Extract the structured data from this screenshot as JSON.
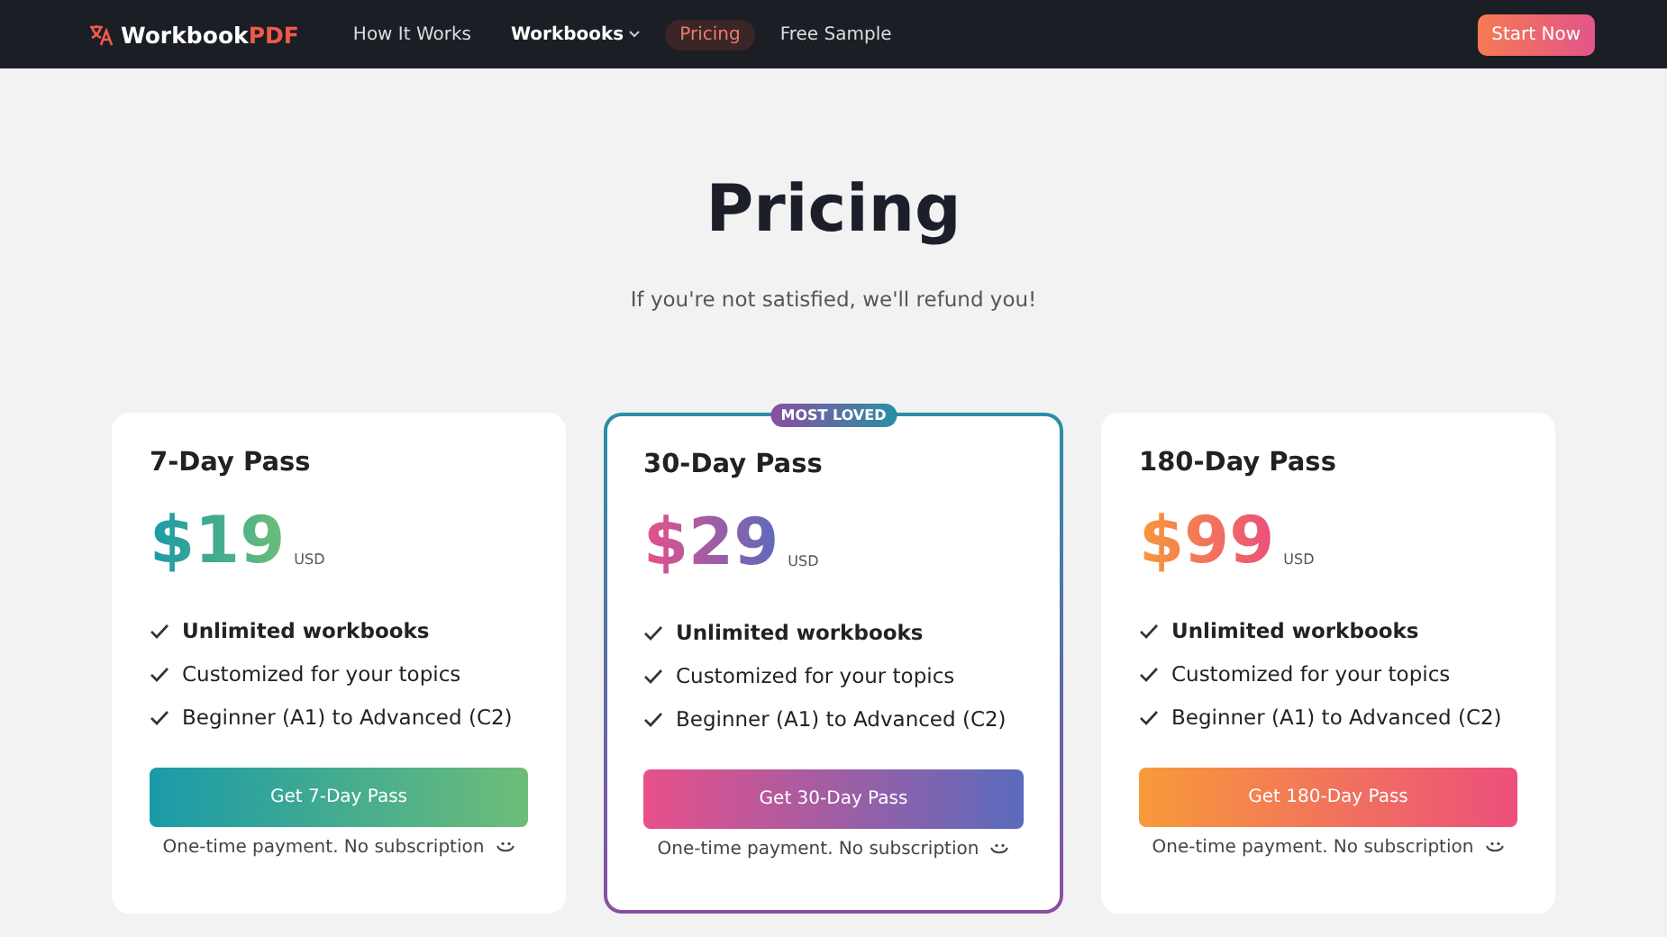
{
  "nav": {
    "brand": {
      "name": "Workbook",
      "accent": "PDF"
    },
    "links": [
      {
        "label": "How It Works",
        "selected": false,
        "dropdown": false
      },
      {
        "label": "Workbooks",
        "selected": false,
        "dropdown": true
      },
      {
        "label": "Pricing",
        "selected": true,
        "dropdown": false
      },
      {
        "label": "Free Sample",
        "selected": false,
        "dropdown": false
      }
    ],
    "cta": "Start Now"
  },
  "header": {
    "title": "Pricing",
    "subtitle": "If you're not satisfied, we'll refund you!"
  },
  "plans": [
    {
      "name": "7-Day Pass",
      "price": "$19",
      "currency": "USD",
      "kind": "teal",
      "featured": false,
      "features": [
        {
          "text": "Unlimited workbooks",
          "bold": true
        },
        {
          "text": "Customized for your topics",
          "bold": false
        },
        {
          "text": "Beginner (A1) to Advanced (C2)",
          "bold": false
        }
      ],
      "button": "Get 7-Day Pass",
      "note": "One-time payment. No subscription"
    },
    {
      "name": "30-Day Pass",
      "price": "$29",
      "currency": "USD",
      "kind": "berry",
      "featured": true,
      "badge": "MOST LOVED",
      "features": [
        {
          "text": "Unlimited workbooks",
          "bold": true
        },
        {
          "text": "Customized for your topics",
          "bold": false
        },
        {
          "text": "Beginner (A1) to Advanced (C2)",
          "bold": false
        }
      ],
      "button": "Get 30-Day Pass",
      "note": "One-time payment. No subscription"
    },
    {
      "name": "180-Day Pass",
      "price": "$99",
      "currency": "USD",
      "kind": "sunset",
      "featured": false,
      "features": [
        {
          "text": "Unlimited workbooks",
          "bold": true
        },
        {
          "text": "Customized for your topics",
          "bold": false
        },
        {
          "text": "Beginner (A1) to Advanced (C2)",
          "bold": false
        }
      ],
      "button": "Get 180-Day Pass",
      "note": "One-time payment. No subscription"
    }
  ]
}
